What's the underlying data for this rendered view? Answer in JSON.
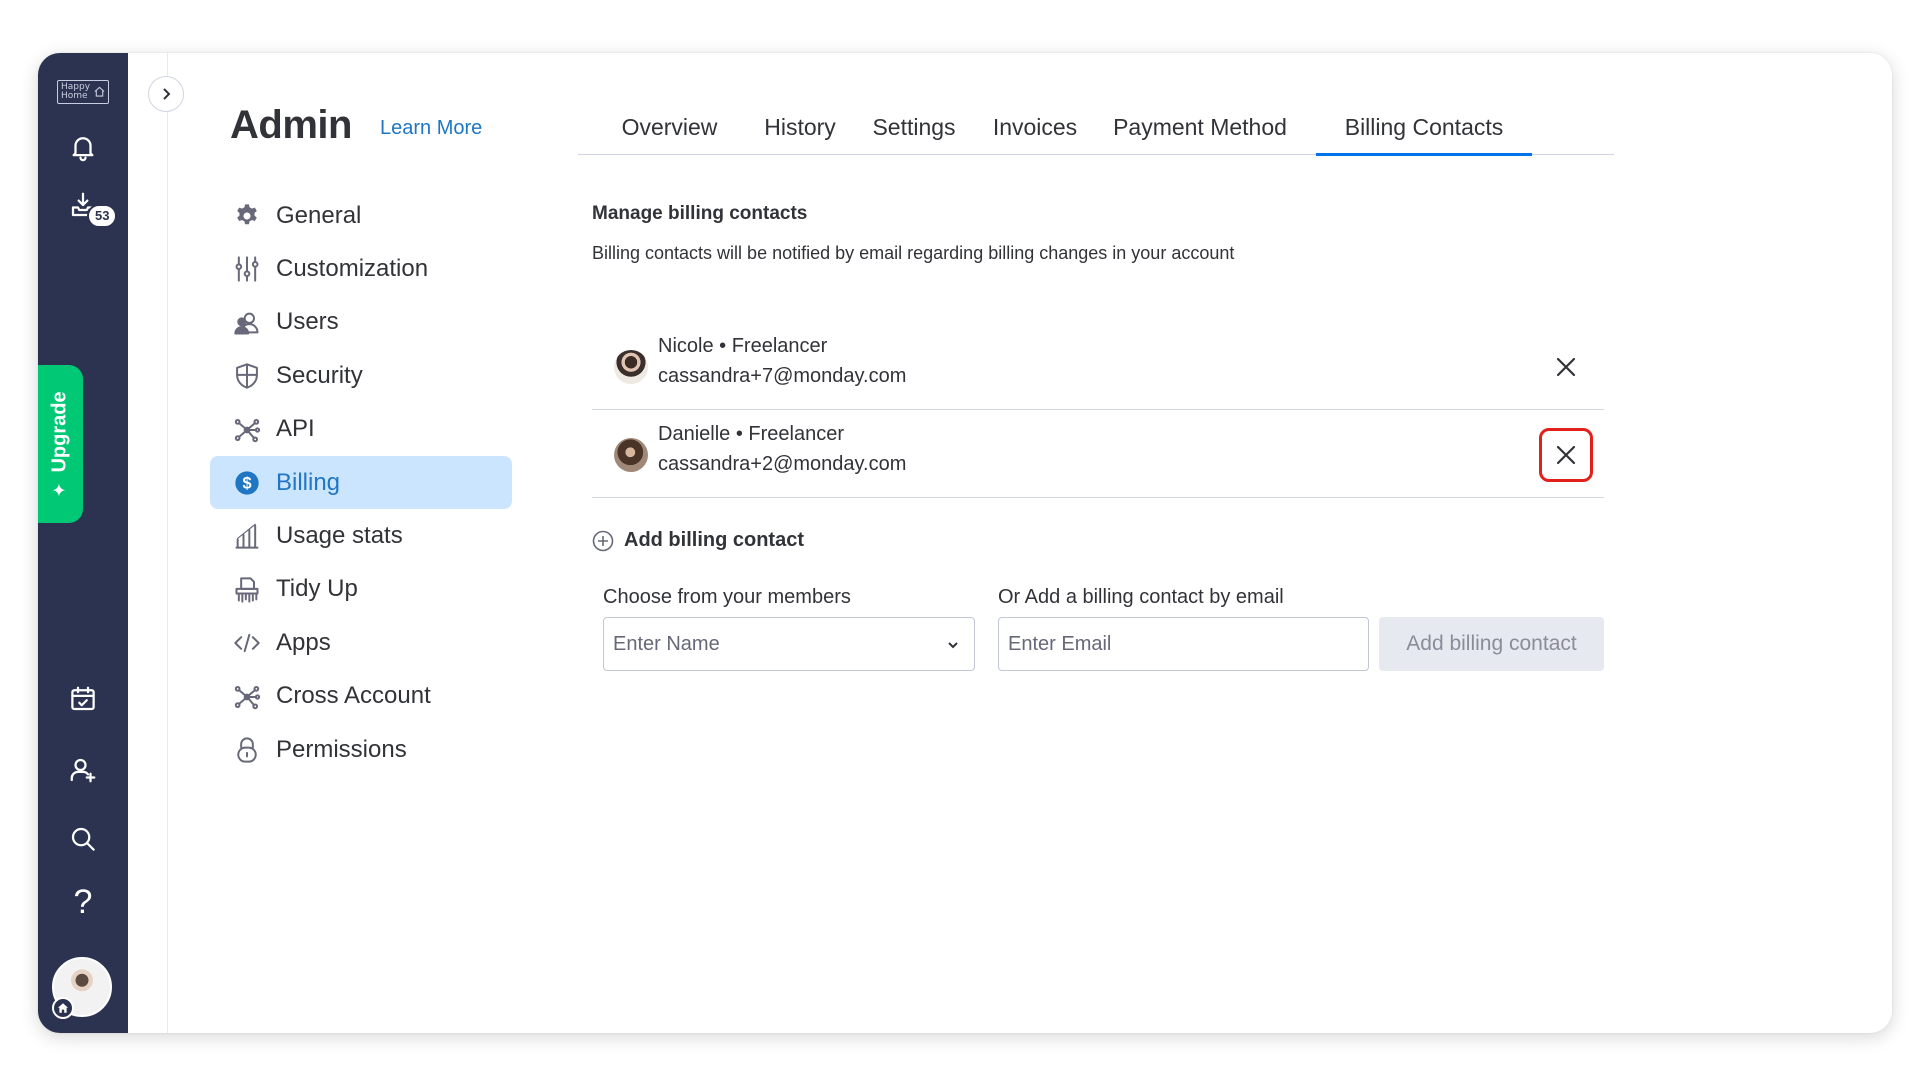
{
  "rail": {
    "logo_text": "Happy Home",
    "badge_count": "53",
    "upgrade_label": "Upgrade",
    "help_glyph": "?",
    "icons": [
      "bell-icon",
      "inbox-download-icon",
      "calendar-check-icon",
      "invite-user-icon",
      "search-icon",
      "help-icon"
    ]
  },
  "admin": {
    "title": "Admin",
    "learn_more": "Learn More"
  },
  "menu": {
    "items": [
      {
        "label": "General",
        "icon": "gear-icon"
      },
      {
        "label": "Customization",
        "icon": "sliders-icon"
      },
      {
        "label": "Users",
        "icon": "users-icon"
      },
      {
        "label": "Security",
        "icon": "shield-icon"
      },
      {
        "label": "API",
        "icon": "api-network-icon"
      },
      {
        "label": "Billing",
        "icon": "dollar-coin-icon",
        "active": true
      },
      {
        "label": "Usage stats",
        "icon": "bar-chart-icon"
      },
      {
        "label": "Tidy Up",
        "icon": "shredder-icon"
      },
      {
        "label": "Apps",
        "icon": "code-icon"
      },
      {
        "label": "Cross Account",
        "icon": "network-icon"
      },
      {
        "label": "Permissions",
        "icon": "lock-icon"
      }
    ]
  },
  "tabs": {
    "items": [
      {
        "label": "Overview"
      },
      {
        "label": "History"
      },
      {
        "label": "Settings"
      },
      {
        "label": "Invoices"
      },
      {
        "label": "Payment Method"
      },
      {
        "label": "Billing Contacts",
        "active": true
      }
    ]
  },
  "billing_contacts": {
    "title": "Manage billing contacts",
    "description": "Billing contacts will be notified by email regarding billing changes in your account",
    "contacts": [
      {
        "name_role": "Nicole • Freelancer",
        "email": "cassandra+7@monday.com"
      },
      {
        "name_role": "Danielle • Freelancer",
        "email": "cassandra+2@monday.com",
        "remove_highlighted": true
      }
    ],
    "add_heading": "Add billing contact",
    "members_label": "Choose from your members",
    "members_placeholder": "Enter Name",
    "email_label": "Or Add a billing contact by email",
    "email_placeholder": "Enter Email",
    "add_button": "Add billing contact"
  },
  "colors": {
    "rail_bg": "#2b3350",
    "upgrade_green": "#00c875",
    "active_blue": "#0073ea",
    "active_bg": "#cce5ff",
    "highlight_red": "#e2211c"
  }
}
